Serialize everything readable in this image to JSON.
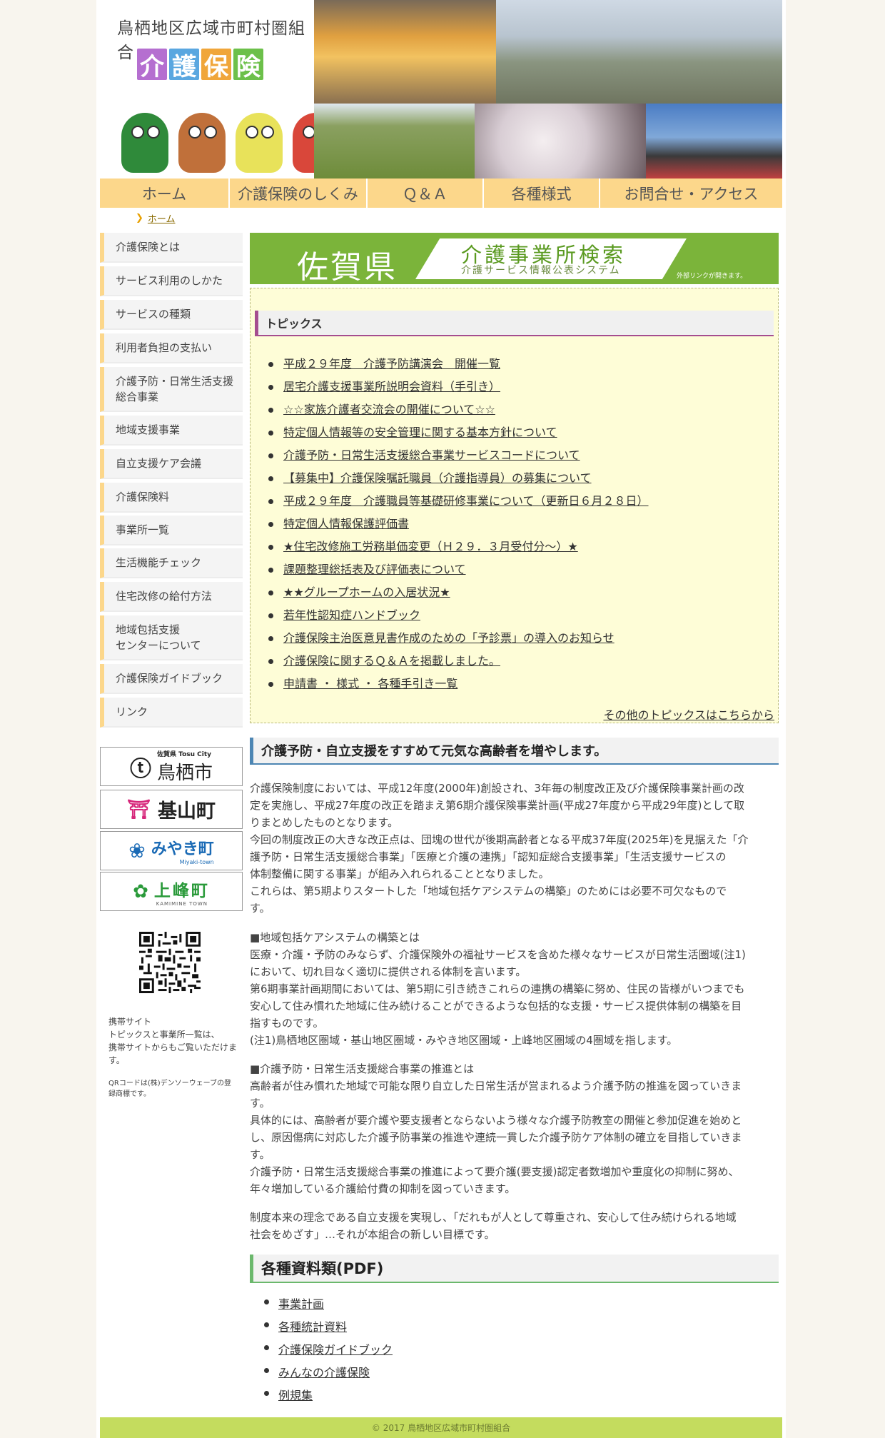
{
  "header": {
    "site_title": "鳥栖地区広域市町村圏組合",
    "logo_chars": [
      "介",
      "護",
      "保",
      "険"
    ],
    "logo_colors": [
      "#b56fd0",
      "#5aa7e0",
      "#f0a63a",
      "#6cc04a"
    ]
  },
  "nav": {
    "items": [
      "ホーム",
      "介護保険のしくみ",
      "Ｑ＆Ａ",
      "各種様式",
      "お問合せ・アクセス"
    ]
  },
  "breadcrumb": {
    "home": "ホーム"
  },
  "sidebar": {
    "items": [
      "介護保険とは",
      "サービス利用のしかた",
      "サービスの種類",
      "利用者負担の支払い",
      "介護予防・日常生活支援総合事業",
      "地域支援事業",
      "自立支援ケア会議",
      "介護保険料",
      "事業所一覧",
      "生活機能チェック",
      "住宅改修の給付方法",
      "地域包括支援センターについて",
      "介護保険ガイドブック",
      "リンク"
    ],
    "item_lines": [
      [],
      [],
      [],
      [],
      [
        "介護予防・日常生活支援",
        "総合事業"
      ],
      [],
      [],
      [],
      [],
      [],
      [],
      [
        "地域包括支援",
        "センターについて"
      ],
      [],
      []
    ],
    "cities": [
      {
        "pref": "佐賀県",
        "sub": "Tosu City",
        "name": "鳥栖市",
        "color": "#222222"
      },
      {
        "name": "基山町",
        "color": "#d6267a"
      },
      {
        "name": "みやき町",
        "sub": "Miyaki-town",
        "color": "#1a6ab5"
      },
      {
        "name": "上峰町",
        "sub": "KAMIMINE TOWN",
        "color": "#2a9a3a"
      }
    ],
    "mobile_note": [
      "携帯サイト",
      "トピックスと事業所一覧は、",
      "携帯サイトからもご覧いただけます。"
    ],
    "qr_note": "QRコードは(株)デンソーウェーブの登録商標です。"
  },
  "banner": {
    "pref": "佐賀県",
    "title": "介護事業所検索",
    "subtitle": "介護サービス情報公表システム",
    "note": "外部リンクが開きます。"
  },
  "topics": {
    "heading": "トピックス",
    "items": [
      "平成２９年度　介護予防講演会　開催一覧",
      "居宅介護支援事業所説明会資料（手引き）",
      "☆☆家族介護者交流会の開催について☆☆",
      "特定個人情報等の安全管理に関する基本方針について",
      "介護予防・日常生活支援総合事業サービスコードについて",
      "【募集中】介護保険嘱託職員（介護指導員）の募集について",
      "平成２９年度　介護職員等基礎研修事業について（更新日６月２８日）",
      "特定個人情報保護評価書",
      "★住宅改修施工労務単価変更（Ｈ２９．３月受付分～）★",
      "課題整理総括表及び評価表について",
      "★★グループホームの入居状況★",
      "若年性認知症ハンドブック",
      "介護保険主治医意見書作成のための「予診票」の導入のお知らせ",
      "介護保険に関するＱ＆Ａを掲載しました。",
      "申請書 ・ 様式 ・ 各種手引き一覧"
    ],
    "more": "その他のトピックスはこちらから"
  },
  "intro": {
    "heading": "介護予防・自立支援をすすめて元気な高齢者を増やします。",
    "para1": [
      "介護保険制度においては、平成12年度(2000年)創設され、3年毎の制度改正及び介護保険事業計画の改",
      "定を実施し、平成27年度の改正を踏まえ第6期介護保険事業計画(平成27年度から平成29年度)として取",
      "りまとめしたものとなります。",
      "今回の制度改正の大きな改正点は、団塊の世代が後期高齢者となる平成37年度(2025年)を見据えた「介",
      "護予防・日常生活支援総合事業」「医療と介護の連携」「認知症総合支援事業」「生活支援サービスの",
      "体制整備に関する事業」が組み入れられることとなりました。",
      "これらは、第5期よりスタートした「地域包括ケアシステムの構築」のためには必要不可欠なもので",
      "す。"
    ],
    "para2": [
      "■地域包括ケアシステムの構築とは",
      "医療・介護・予防のみならず、介護保険外の福祉サービスを含めた様々なサービスが日常生活圏域(注1)",
      "において、切れ目なく適切に提供される体制を言います。",
      "第6期事業計画期間においては、第5期に引き続きこれらの連携の構築に努め、住民の皆様がいつまでも",
      "安心して住み慣れた地域に住み続けることができるような包括的な支援・サービス提供体制の構築を目",
      "指すものです。",
      "(注1)鳥栖地区圏域・基山地区圏域・みやき地区圏域・上峰地区圏域の4圏域を指します。"
    ],
    "para3": [
      "■介護予防・日常生活支援総合事業の推進とは",
      "高齢者が住み慣れた地域で可能な限り自立した日常生活が営まれるよう介護予防の推進を図っていきま",
      "す。",
      "具体的には、高齢者が要介護や要支援者とならないよう様々な介護予防教室の開催と参加促進を始めと",
      "し、原因傷病に対応した介護予防事業の推進や連続一貫した介護予防ケア体制の確立を目指していきま",
      "す。",
      "介護予防・日常生活支援総合事業の推進によって要介護(要支援)認定者数増加や重度化の抑制に努め、",
      "年々増加している介護給付費の抑制を図っていきます。"
    ],
    "para4": [
      "制度本来の理念である自立支援を実現し、「だれもが人として尊重され、安心して住み続けられる地域",
      "社会をめざす」…それが本組合の新しい目標です。"
    ]
  },
  "pdf": {
    "heading": "各種資料類(PDF)",
    "items": [
      "事業計画",
      "各種統計資料",
      "介護保険ガイドブック",
      "みんなの介護保険",
      "例規集"
    ]
  },
  "footer": {
    "copyright": "© 2017 鳥栖地区広域市町村圏組合"
  }
}
